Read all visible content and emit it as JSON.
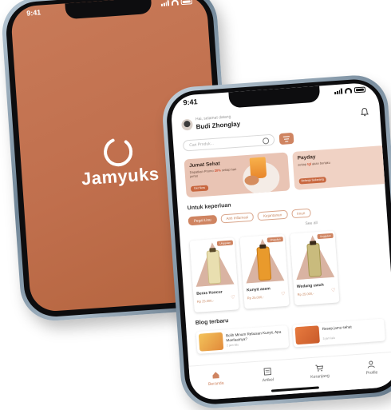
{
  "splash": {
    "status_time": "9:41",
    "app_name": "Jamyuks",
    "background_color": "#c2704d"
  },
  "home": {
    "status_time": "9:41",
    "greeting": "Hai, selamat datang",
    "user_name": "Budi Zhonglay",
    "search_placeholder": "Cari Produk...",
    "promos": [
      {
        "title": "Jumat Sehat",
        "desc_prefix": "Dapatkan Promo ",
        "desc_highlight": "20%",
        "desc_suffix": " setiap hari jumat",
        "button": "Get Now"
      },
      {
        "title": "Payday",
        "desc_prefix": "setiap ",
        "desc_highlight": "tgl",
        "desc_suffix": " akan berlaku",
        "button": "Belanja Sekarang"
      }
    ],
    "section_needs": "Untuk keperluan",
    "see_all": "See all",
    "chips": [
      "Pegal Linu",
      "Anti Inflamasi",
      "Kejantanan",
      "Imun"
    ],
    "products": [
      {
        "badge": "Unggulan",
        "name": "Beras Kencur",
        "price": "Rp 25.000,-"
      },
      {
        "badge": "Unggulan",
        "name": "Kunyit asem",
        "price": "Rp 25.000,-"
      },
      {
        "badge": "Unggulan",
        "name": "Wedang uwuh",
        "price": "Rp 25.000,-"
      }
    ],
    "section_blog": "Blog terbaru",
    "blogs": [
      {
        "title": "Bolih Minum Rebusan Kunyit, Apa Manfaatnya?",
        "date": "2 jam lalu"
      },
      {
        "title": "Resep jamu sehat",
        "date": "3 jam lalu"
      }
    ],
    "nav": [
      "Beranda",
      "Artikel",
      "Keranjang",
      "Profile"
    ],
    "accent_color": "#cf8461"
  }
}
